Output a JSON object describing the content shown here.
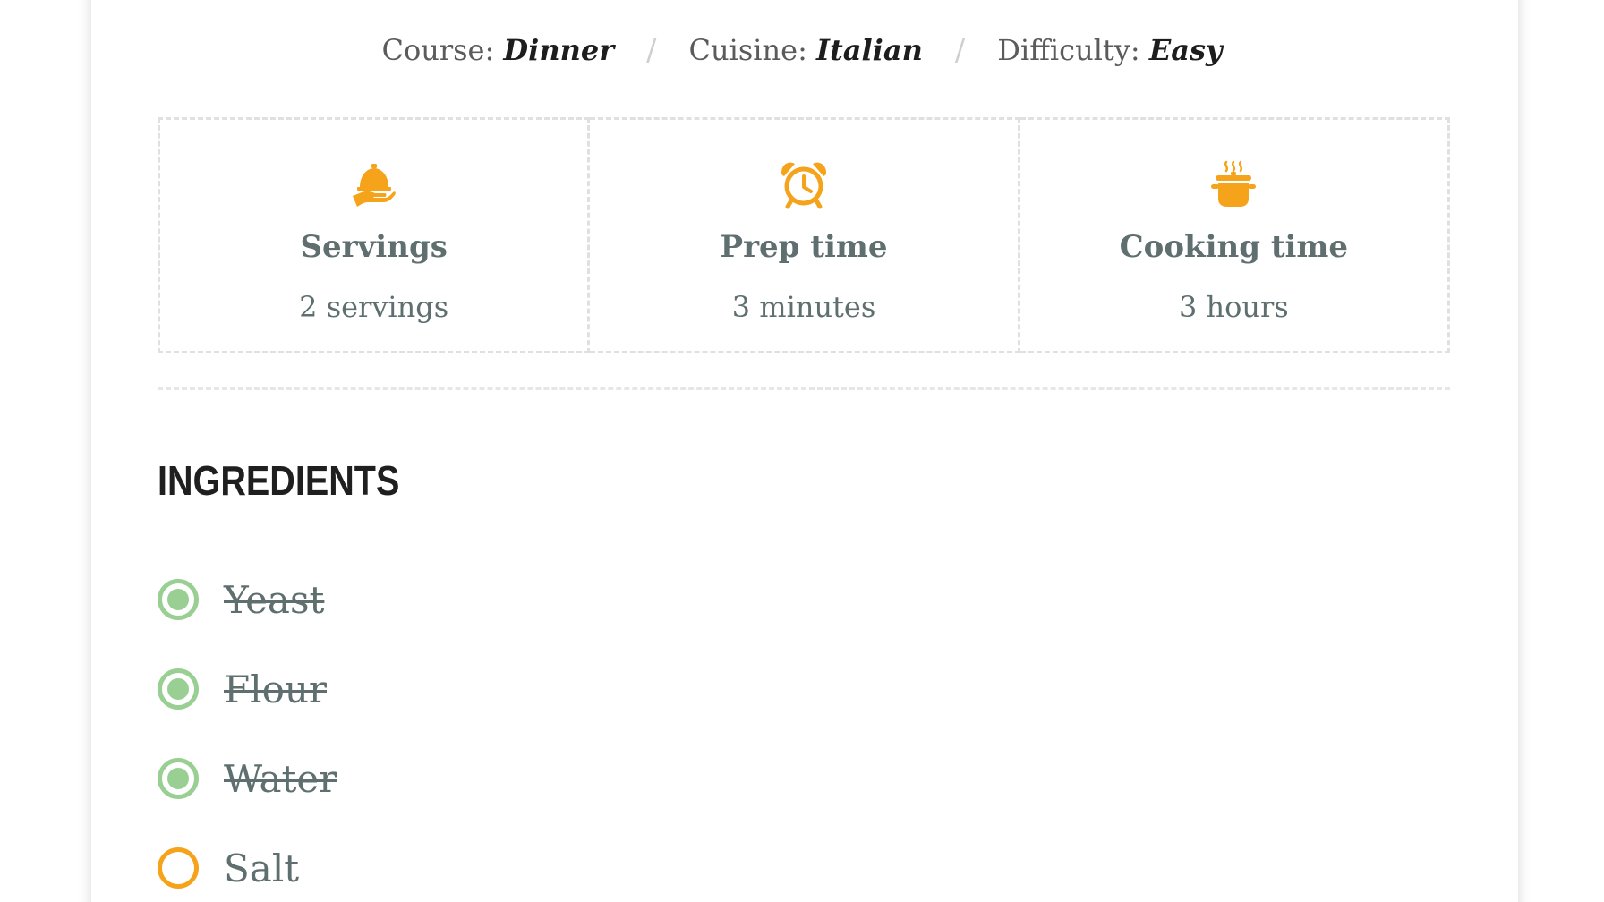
{
  "meta": {
    "course_label": "Course:",
    "course_value": "Dinner",
    "cuisine_label": "Cuisine:",
    "cuisine_value": "Italian",
    "difficulty_label": "Difficulty:",
    "difficulty_value": "Easy",
    "separator": "/"
  },
  "stats": [
    {
      "icon": "serving-cloche-icon",
      "label": "Servings",
      "value": "2 servings"
    },
    {
      "icon": "alarm-clock-icon",
      "label": "Prep time",
      "value": "3 minutes"
    },
    {
      "icon": "cooking-pot-icon",
      "label": "Cooking time",
      "value": "3 hours"
    }
  ],
  "ingredients": {
    "heading": "INGREDIENTS",
    "items": [
      {
        "name": "Yeast",
        "checked": true
      },
      {
        "name": "Flour",
        "checked": true
      },
      {
        "name": "Water",
        "checked": true
      },
      {
        "name": "Salt",
        "checked": false
      }
    ]
  },
  "colors": {
    "accent": "#f5a31a",
    "checked": "#99cf93",
    "text_muted": "#5f6f6f"
  }
}
